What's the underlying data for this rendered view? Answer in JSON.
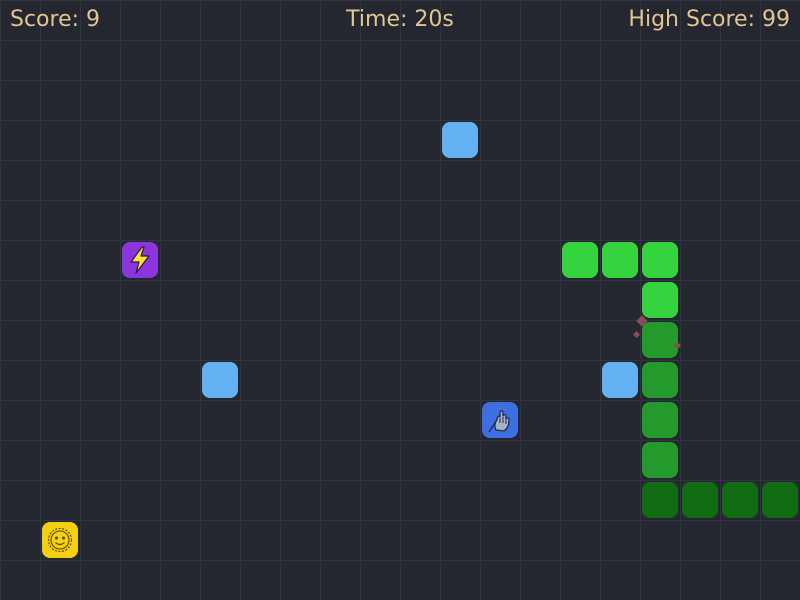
{
  "hud": {
    "score_label": "Score: 9",
    "time_label": "Time: 20s",
    "high_score_label": "High Score: 99"
  },
  "colors": {
    "background": "#242730",
    "grid_line": "#30343e",
    "hud_text": "#e3c58f",
    "food": "#63b0f2",
    "snake_head_section": "#35d43f",
    "snake_mid_section": "#259a2c",
    "snake_tail_section": "#106b13",
    "powerup_speed": "#8b35dd",
    "powerup_ghost": "#3d6fe0",
    "powerup_sun": "#f5cf12",
    "particles": "#8f4a55"
  },
  "board": {
    "columns": 20,
    "rows": 15,
    "grid_visible": true
  },
  "snake": {
    "direction": "left",
    "length": 12,
    "segments": [
      {
        "col": 14,
        "row": 6,
        "shade": "bright"
      },
      {
        "col": 15,
        "row": 6,
        "shade": "bright"
      },
      {
        "col": 16,
        "row": 6,
        "shade": "bright"
      },
      {
        "col": 16,
        "row": 7,
        "shade": "bright"
      },
      {
        "col": 16,
        "row": 8,
        "shade": "mid"
      },
      {
        "col": 16,
        "row": 9,
        "shade": "mid"
      },
      {
        "col": 16,
        "row": 10,
        "shade": "mid"
      },
      {
        "col": 16,
        "row": 11,
        "shade": "mid"
      },
      {
        "col": 16,
        "row": 12,
        "shade": "dark"
      },
      {
        "col": 17,
        "row": 12,
        "shade": "dark"
      },
      {
        "col": 18,
        "row": 12,
        "shade": "dark"
      },
      {
        "col": 19,
        "row": 12,
        "shade": "dark"
      }
    ]
  },
  "food": [
    {
      "col": 11,
      "row": 3
    },
    {
      "col": 5,
      "row": 9
    },
    {
      "col": 15,
      "row": 9
    }
  ],
  "powerups": [
    {
      "kind": "speed",
      "icon": "lightning-bolt-icon",
      "col": 3,
      "row": 6
    },
    {
      "kind": "ghost",
      "icon": "ghost-hand-icon",
      "col": 12,
      "row": 10
    },
    {
      "kind": "sun",
      "icon": "smiling-sun-icon",
      "col": 1,
      "row": 13
    }
  ]
}
